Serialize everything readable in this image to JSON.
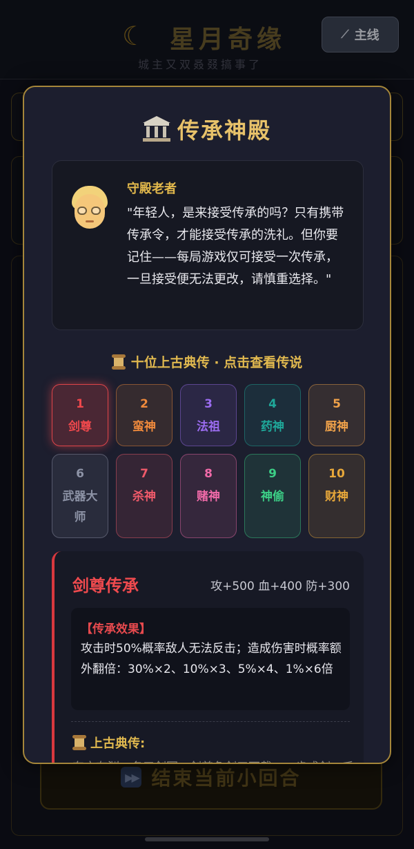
{
  "header": {
    "title": "星月奇缘",
    "subtitle": "城主又双叒叕搞事了",
    "main_button_label": "主线"
  },
  "background": {
    "end_round_label": "结束当前小回合"
  },
  "modal": {
    "title": "传承神殿",
    "elder": {
      "name": "守殿老者",
      "quote": "\"年轻人，是来接受传承的吗？只有携带传承令，才能接受传承的洗礼。但你要记住——每局游戏仅可接受一次传承，一旦接受便无法更改，请慎重选择。\""
    },
    "section_title": "十位上古典传 · 点击查看传说",
    "inheritances": [
      {
        "num": "1",
        "name": "剑尊",
        "color": "#f0484c",
        "selected": true
      },
      {
        "num": "2",
        "name": "蛮神",
        "color": "#f08a3c"
      },
      {
        "num": "3",
        "name": "法祖",
        "color": "#9b6cf0"
      },
      {
        "num": "4",
        "name": "药神",
        "color": "#1fa89a"
      },
      {
        "num": "5",
        "name": "厨神",
        "color": "#f0a24a"
      },
      {
        "num": "6",
        "name": "武器大师",
        "color": "#8d93a6"
      },
      {
        "num": "7",
        "name": "杀神",
        "color": "#f05a6a"
      },
      {
        "num": "8",
        "name": "赌神",
        "color": "#f06aa8"
      },
      {
        "num": "9",
        "name": "神偷",
        "color": "#3ccf86"
      },
      {
        "num": "10",
        "name": "财神",
        "color": "#e8a83a"
      }
    ],
    "detail": {
      "title": "剑尊传承",
      "stats": "攻+500 血+400 防+300",
      "effect_label": "【传承效果】",
      "effect_text": "攻击时50%概率敌人无法反击；造成伤害时概率额外翻倍：30%×2、10%×3、5%×4、1%×6倍",
      "legend_title": "上古典传:",
      "legend_text": "东方有渊，名曰剑冢，剑尊负剑三万载，一步成剑，千"
    }
  }
}
